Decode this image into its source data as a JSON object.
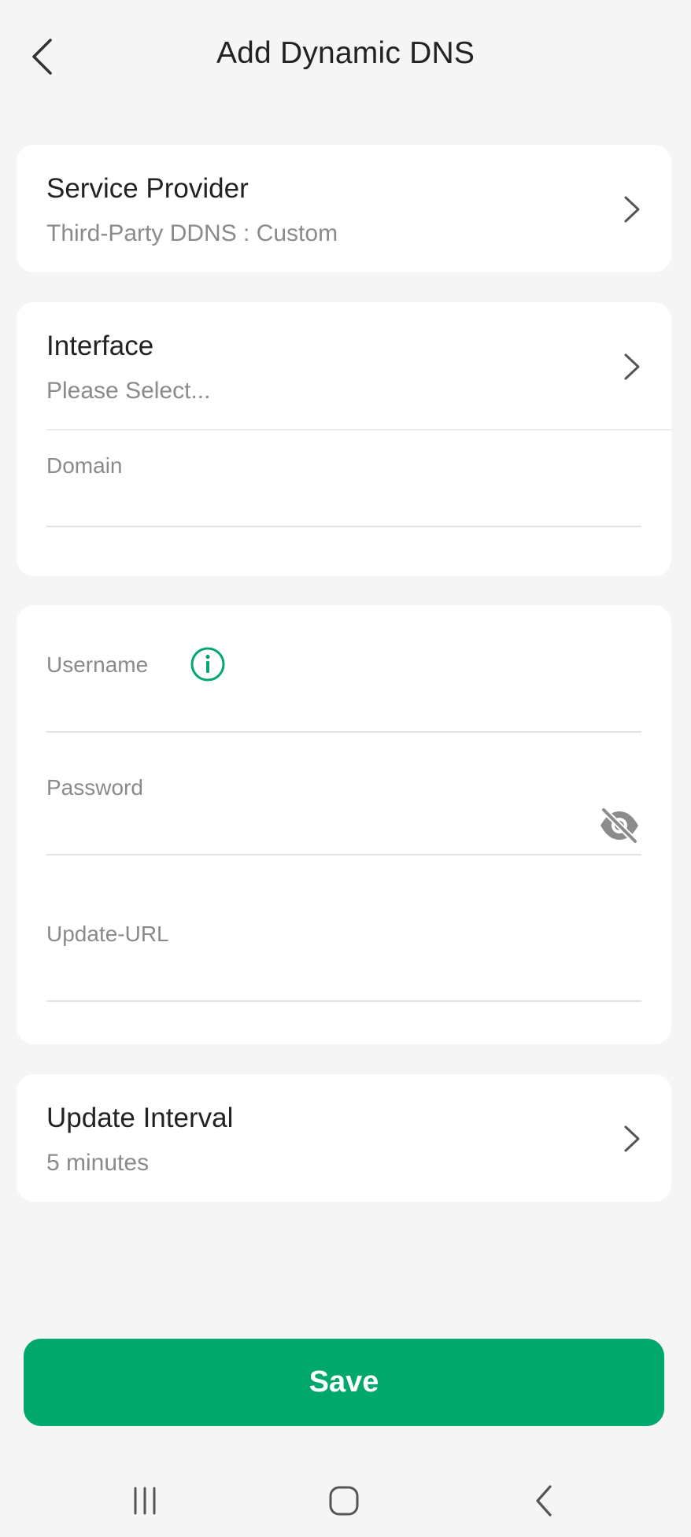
{
  "header": {
    "title": "Add Dynamic DNS",
    "back_icon": "chevron-left-icon"
  },
  "service_provider": {
    "title": "Service Provider",
    "value": "Third-Party DDNS : Custom"
  },
  "interface": {
    "title": "Interface",
    "value": "Please Select..."
  },
  "domain": {
    "label": "Domain",
    "value": ""
  },
  "username": {
    "label": "Username",
    "value": "",
    "info_icon": "info-icon"
  },
  "password": {
    "label": "Password",
    "value": "",
    "visibility_icon": "eye-off-icon"
  },
  "update_url": {
    "label": "Update-URL",
    "value": ""
  },
  "update_interval": {
    "title": "Update Interval",
    "value": "5 minutes"
  },
  "save_label": "Save",
  "colors": {
    "accent": "#00a86b",
    "background": "#f5f5f5",
    "card": "#ffffff",
    "primary_text": "#222222",
    "secondary_text": "#8a8a8a"
  },
  "system_nav": {
    "items": [
      "recent-apps-icon",
      "home-icon",
      "back-icon"
    ]
  }
}
